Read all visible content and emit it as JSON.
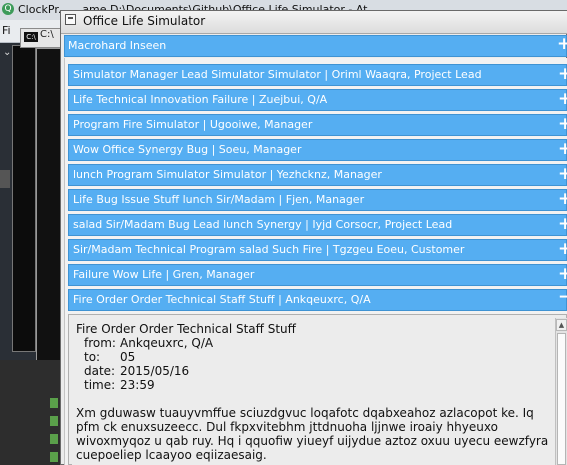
{
  "background": {
    "ide_title": "ClockPr... ...ame D:\\Documents\\Github\\Office Life Simulator - At...",
    "menu_file": "Fi",
    "console_title": "C:\\",
    "app_icon_letter": "Q"
  },
  "window": {
    "title": "Office Life Simulator"
  },
  "company": {
    "name": "Macrohard Inseen",
    "toggle": "+"
  },
  "emails": [
    {
      "label": "Simulator Manager Lead Simulator Simulator | Oriml Waaqra, Project Lead",
      "toggle": "+"
    },
    {
      "label": "Life Technical Innovation Failure | Zuejbui, Q/A",
      "toggle": "+"
    },
    {
      "label": "Program Fire Simulator | Ugooiwe, Manager",
      "toggle": "+"
    },
    {
      "label": "Wow Office Synergy Bug | Soeu, Manager",
      "toggle": "+"
    },
    {
      "label": "lunch Program Simulator Simulator | Yezhcknz, Manager",
      "toggle": "+"
    },
    {
      "label": "Life Bug Issue Stuff lunch Sir/Madam | Fjen, Manager",
      "toggle": "+"
    },
    {
      "label": "salad Sir/Madam Bug Lead lunch Synergy | Iyjd Corsocr, Project Lead",
      "toggle": "+"
    },
    {
      "label": "Sir/Madam Technical Program salad Such Fire | Tgzgeu Eoeu, Customer",
      "toggle": "+"
    },
    {
      "label": "Failure Wow Life | Gren, Manager",
      "toggle": "+"
    },
    {
      "label": "Fire Order Order Technical Staff Stuff | Ankqeuxrc, Q/A",
      "toggle": "−"
    }
  ],
  "open_email": {
    "subject": "Fire Order Order Technical Staff Stuff",
    "from_label": "from:",
    "from": "Ankqeuxrc, Q/A",
    "to_label": "to:",
    "to": "05",
    "date_label": "date:",
    "date": "2015/05/16",
    "time_label": "time:",
    "time": "23:59",
    "body": "Xm gduwasw tuauyvmffue sciuzdgvuc loqafotc dqabxeahoz azlacopot ke. Iq pfm ck enuxsuzeecc. Dul fkpxvitebhm jttdnuoha ljjnwe iroaiy hhyeuxo wivoxmyqoz u qab ruy. Hq i qquofiw yiueyf uijydue aztoz oxuu uyecu eewzfyra cuepoeliep lcaayoo eqiizaesaig."
  }
}
